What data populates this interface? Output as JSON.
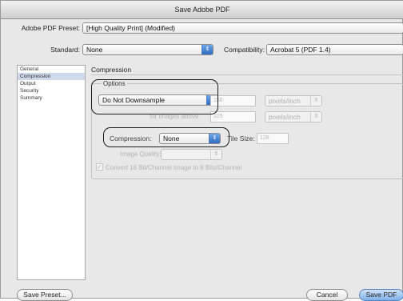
{
  "window": {
    "title": "Save Adobe PDF"
  },
  "preset": {
    "label": "Adobe PDF Preset:",
    "value": "[High Quality Print] (Modified)"
  },
  "standard": {
    "label": "Standard:",
    "value": "None"
  },
  "compatibility": {
    "label": "Compatibility:",
    "value": "Acrobat 5 (PDF 1.4)"
  },
  "sidebar": {
    "items": [
      {
        "label": "General",
        "selected": false
      },
      {
        "label": "Compression",
        "selected": true
      },
      {
        "label": "Output",
        "selected": false
      },
      {
        "label": "Security",
        "selected": false
      },
      {
        "label": "Summary",
        "selected": false
      }
    ]
  },
  "panel": {
    "title": "Compression",
    "options_legend": "Options",
    "downsample": "Do Not Downsample",
    "downsample_ppi": "150",
    "downsample_units": "pixels/inch",
    "above_label": "for images above:",
    "above_ppi": "225",
    "above_units": "pixels/inch",
    "compression_label": "Compression:",
    "compression_value": "None",
    "tile_label": "Tile Size:",
    "tile_value": "128",
    "quality_label": "Image Quality:",
    "quality_value": "",
    "convert_label": "Convert 16 Bit/Channel Image to 8 Bits/Channel",
    "convert_checked": true
  },
  "buttons": {
    "save_preset": "Save Preset...",
    "cancel": "Cancel",
    "save_pdf": "Save PDF"
  },
  "icons": {
    "popup_arrows": "⇕",
    "checkmark": "✓"
  },
  "colors": {
    "accent": "#3a7bd5",
    "selected_row": "#cfd9ec"
  }
}
